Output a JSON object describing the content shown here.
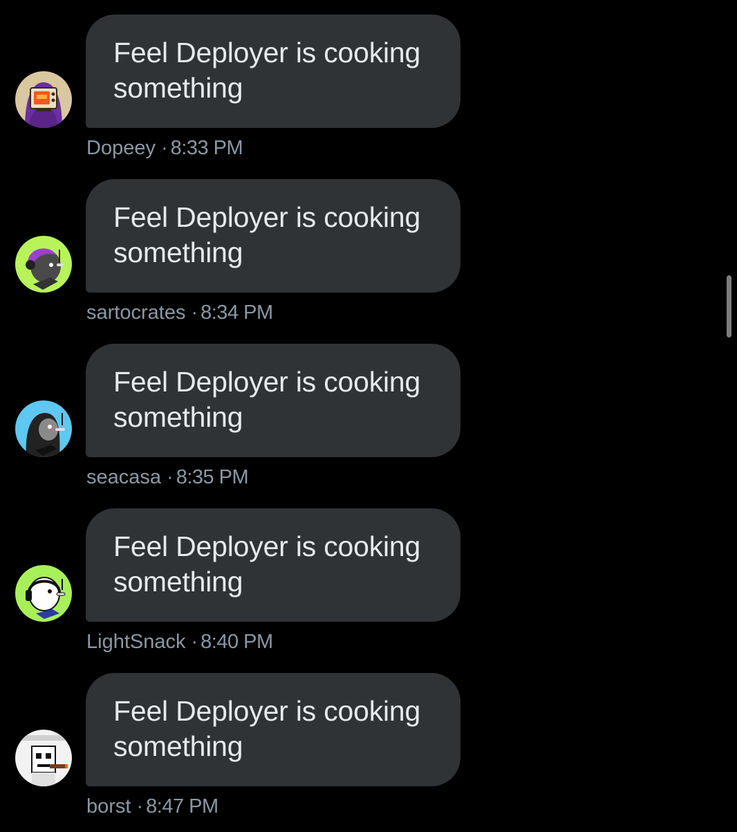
{
  "messages": [
    {
      "text": "Feel Deployer is cooking something",
      "author": "Dopeey",
      "separator": "·",
      "time": "8:33 PM",
      "avatar_icon": "purple-hoodie-tv-avatar-icon",
      "avatar_bg": "#d9c7a0"
    },
    {
      "text": "Feel Deployer is cooking something",
      "author": "sartocrates",
      "separator": "·",
      "time": "8:34 PM",
      "avatar_icon": "green-gamer-bird-avatar-icon",
      "avatar_bg": "#b8f35a"
    },
    {
      "text": "Feel Deployer is cooking something",
      "author": "seacasa",
      "separator": "·",
      "time": "8:35 PM",
      "avatar_icon": "blue-hooded-bird-avatar-icon",
      "avatar_bg": "#5ec8f0"
    },
    {
      "text": "Feel Deployer is cooking something",
      "author": "LightSnack",
      "separator": "·",
      "time": "8:40 PM",
      "avatar_icon": "green-headset-bird-avatar-icon",
      "avatar_bg": "#a8f05a"
    },
    {
      "text": "Feel Deployer is cooking something",
      "author": "borst",
      "separator": "·",
      "time": "8:47 PM",
      "avatar_icon": "pixel-skull-cigar-avatar-icon",
      "avatar_bg": "#f2f2f2"
    }
  ],
  "colors": {
    "background": "#000000",
    "bubble": "#2f3336",
    "bubble_text": "#e7e9ea",
    "meta_text": "#8b98a5"
  }
}
